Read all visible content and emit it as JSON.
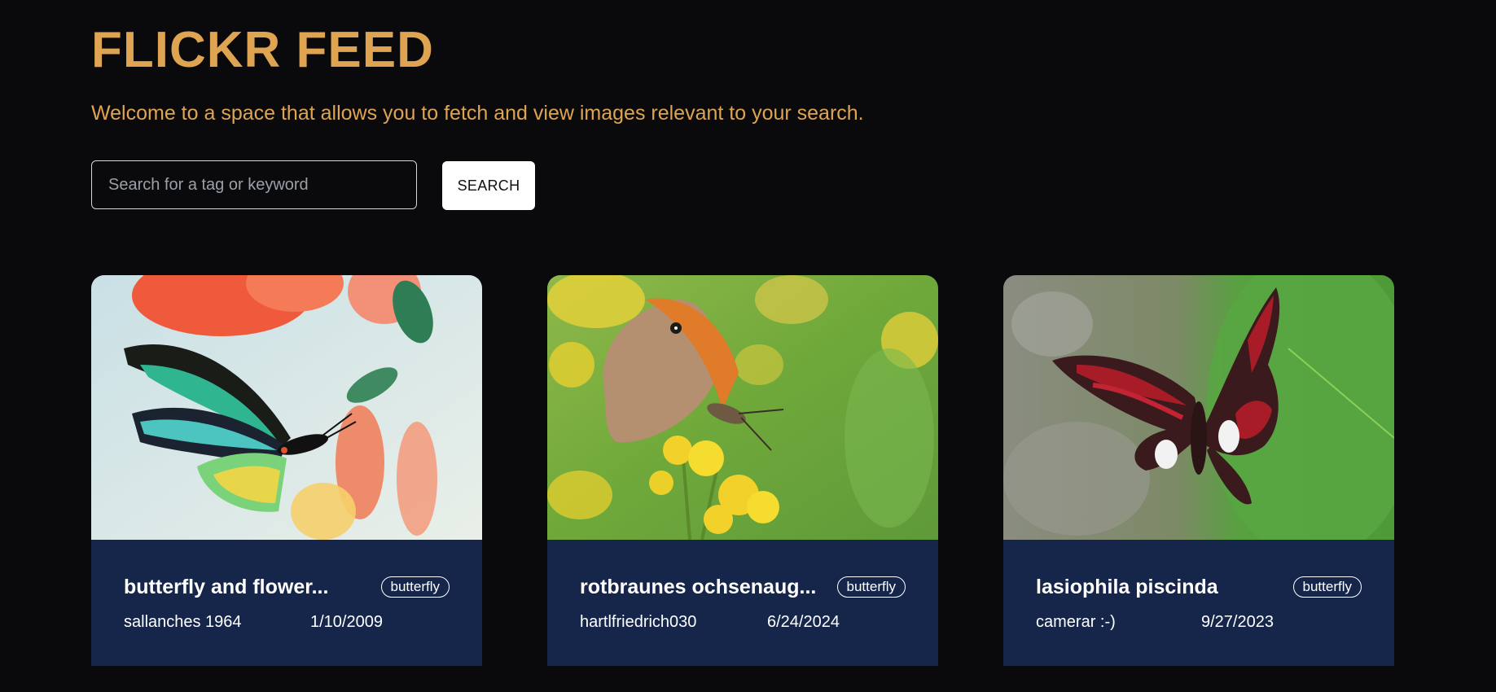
{
  "header": {
    "title": "FLICKR FEED",
    "subtitle": "Welcome to a space that allows you to fetch and view images relevant to your search."
  },
  "search": {
    "placeholder": "Search for a tag or keyword",
    "value": "",
    "button_label": "SEARCH"
  },
  "colors": {
    "background": "#0a0a0c",
    "accent": "#dea452",
    "card_body": "#15264a"
  },
  "cards": [
    {
      "title": "butterfly and flower...",
      "tag": "butterfly",
      "author": "sallanches 1964",
      "date": "1/10/2009"
    },
    {
      "title": "rotbraunes ochsenaug...",
      "tag": "butterfly",
      "author": "hartlfriedrich030",
      "date": "6/24/2024"
    },
    {
      "title": "lasiophila piscinda",
      "tag": "butterfly",
      "author": "camerar :-)",
      "date": "9/27/2023"
    }
  ]
}
